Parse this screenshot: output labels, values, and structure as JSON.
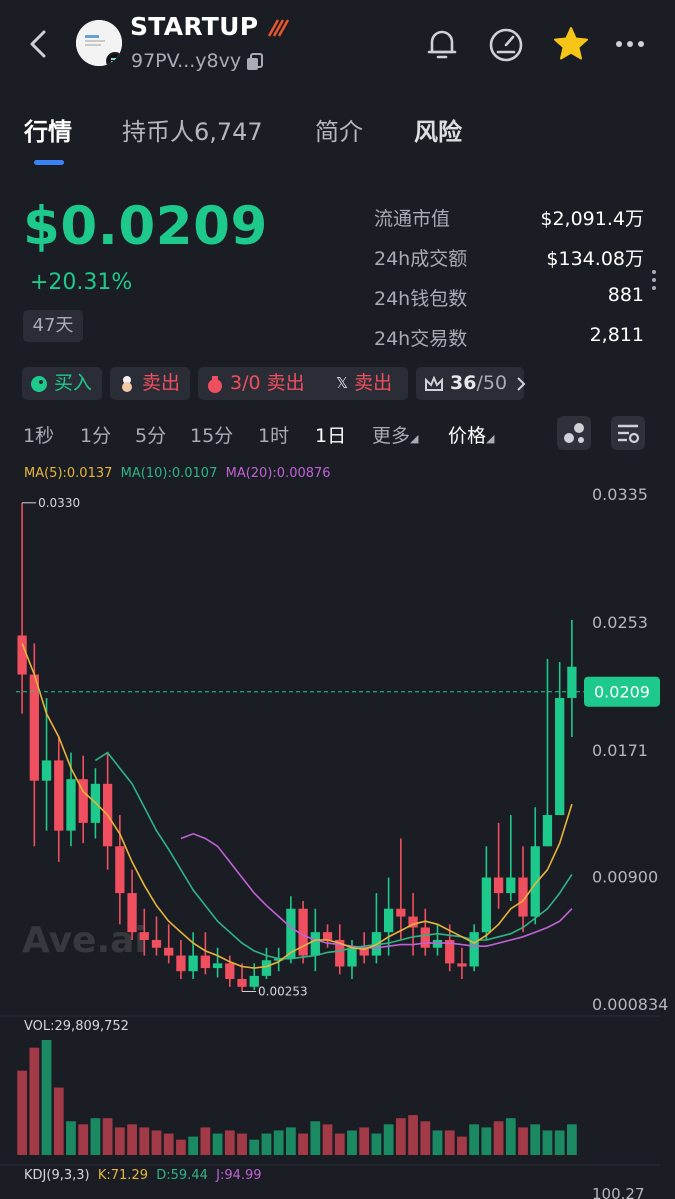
{
  "header": {
    "title": "STARTUP",
    "address": "97PV...y8vy",
    "icons": [
      "back-icon",
      "bell-icon",
      "speedometer-icon",
      "star-icon",
      "more-icon"
    ]
  },
  "tabs": [
    {
      "label": "行情",
      "active": true
    },
    {
      "label": "持币人6,747",
      "active": false
    },
    {
      "label": "简介",
      "active": false
    },
    {
      "label": "风险",
      "active": false
    }
  ],
  "price": {
    "value": "$0.0209",
    "change": "+20.31%",
    "age": "47天"
  },
  "stats": [
    {
      "label": "流通市值",
      "value": "$2,091.4万"
    },
    {
      "label": "24h成交额",
      "value": "$134.08万"
    },
    {
      "label": "24h钱包数",
      "value": "881"
    },
    {
      "label": "24h交易数",
      "value": "2,811"
    }
  ],
  "chips": {
    "buy": "买入",
    "sell1": "卖出",
    "sell2_count": "3/0",
    "sell2": "卖出",
    "sell3": "卖出",
    "rank": "36",
    "rank_total": "/50"
  },
  "timeframes": {
    "items": [
      "1秒",
      "1分",
      "5分",
      "15分",
      "1时",
      "1日",
      "更多",
      "价格"
    ],
    "active": "1日"
  },
  "colors": {
    "up": "#1ec98c",
    "down": "#f04f5f",
    "ma5": "#e7b53a",
    "ma10": "#2eb487",
    "ma20": "#c162d4",
    "accent": "#3b82f6"
  },
  "chart_data": {
    "type": "candlestick",
    "ma_legend": {
      "ma5": "MA(5):0.0137",
      "ma10": "MA(10):0.0107",
      "ma20": "MA(20):0.00876"
    },
    "y_ticks": [
      "0.0335",
      "0.0253",
      "0.0171",
      "0.00900",
      "0.000834"
    ],
    "y_tick_values": [
      0.0335,
      0.0253,
      0.0171,
      0.009,
      0.000834
    ],
    "ylim": [
      0.000834,
      0.0335
    ],
    "current_price_label": "0.0209",
    "current_price": 0.0209,
    "high_label": "0.0330",
    "low_label": "0.00253",
    "candles": [
      [
        0.0245,
        0.022,
        0.033,
        0.0195
      ],
      [
        0.022,
        0.0152,
        0.024,
        0.011
      ],
      [
        0.0152,
        0.0165,
        0.0205,
        0.012
      ],
      [
        0.0165,
        0.012,
        0.018,
        0.01
      ],
      [
        0.012,
        0.0153,
        0.017,
        0.011
      ],
      [
        0.0153,
        0.0125,
        0.0168,
        0.0112
      ],
      [
        0.0125,
        0.015,
        0.016,
        0.0115
      ],
      [
        0.015,
        0.011,
        0.017,
        0.0095
      ],
      [
        0.011,
        0.008,
        0.013,
        0.006
      ],
      [
        0.008,
        0.0055,
        0.0095,
        0.005
      ],
      [
        0.0055,
        0.005,
        0.007,
        0.004
      ],
      [
        0.005,
        0.0045,
        0.0065,
        0.004
      ],
      [
        0.0045,
        0.004,
        0.006,
        0.0035
      ],
      [
        0.004,
        0.003,
        0.005,
        0.0025
      ],
      [
        0.003,
        0.004,
        0.0055,
        0.0025
      ],
      [
        0.004,
        0.0032,
        0.0055,
        0.0028
      ],
      [
        0.0032,
        0.0035,
        0.0045,
        0.0026
      ],
      [
        0.0035,
        0.0025,
        0.004,
        0.002
      ],
      [
        0.0025,
        0.002,
        0.0035,
        0.0017
      ],
      [
        0.002,
        0.0027,
        0.0035,
        0.0018
      ],
      [
        0.0027,
        0.0037,
        0.0045,
        0.0025
      ],
      [
        0.0037,
        0.0038,
        0.0045,
        0.003
      ],
      [
        0.0038,
        0.007,
        0.0078,
        0.0035
      ],
      [
        0.007,
        0.004,
        0.0075,
        0.0035
      ],
      [
        0.004,
        0.0055,
        0.007,
        0.003
      ],
      [
        0.0055,
        0.005,
        0.006,
        0.0045
      ],
      [
        0.005,
        0.0033,
        0.006,
        0.0028
      ],
      [
        0.0033,
        0.0045,
        0.005,
        0.0025
      ],
      [
        0.0045,
        0.004,
        0.0055,
        0.0035
      ],
      [
        0.004,
        0.0055,
        0.008,
        0.0035
      ],
      [
        0.0055,
        0.007,
        0.009,
        0.004
      ],
      [
        0.007,
        0.0065,
        0.0115,
        0.005
      ],
      [
        0.0065,
        0.0058,
        0.008,
        0.004
      ],
      [
        0.0058,
        0.0045,
        0.007,
        0.004
      ],
      [
        0.0045,
        0.005,
        0.006,
        0.004
      ],
      [
        0.005,
        0.0035,
        0.006,
        0.003
      ],
      [
        0.0035,
        0.0033,
        0.0045,
        0.0025
      ],
      [
        0.0033,
        0.0055,
        0.006,
        0.003
      ],
      [
        0.0055,
        0.009,
        0.011,
        0.005
      ],
      [
        0.009,
        0.008,
        0.0125,
        0.007
      ],
      [
        0.008,
        0.009,
        0.013,
        0.0075
      ],
      [
        0.009,
        0.0065,
        0.011,
        0.0055
      ],
      [
        0.0065,
        0.011,
        0.0135,
        0.006
      ],
      [
        0.011,
        0.013,
        0.023,
        0.011
      ],
      [
        0.013,
        0.0205,
        0.0228,
        0.0165
      ],
      [
        0.0205,
        0.0225,
        0.0255,
        0.018
      ]
    ],
    "ma5": [
      0.024,
      0.022,
      0.0195,
      0.018,
      0.016,
      0.0145,
      0.0138,
      0.013,
      0.0118,
      0.01,
      0.0085,
      0.0072,
      0.0062,
      0.0055,
      0.0048,
      0.0043,
      0.004,
      0.0036,
      0.0033,
      0.0032,
      0.0033,
      0.0036,
      0.0042,
      0.0046,
      0.005,
      0.005,
      0.0048,
      0.0045,
      0.0044,
      0.0047,
      0.0052,
      0.0056,
      0.006,
      0.0062,
      0.006,
      0.0056,
      0.0052,
      0.0048,
      0.0053,
      0.006,
      0.007,
      0.0075,
      0.0086,
      0.0095,
      0.0112,
      0.0137
    ],
    "ma10": [
      null,
      null,
      null,
      null,
      null,
      null,
      0.0165,
      0.017,
      0.016,
      0.015,
      0.0135,
      0.012,
      0.0108,
      0.0095,
      0.0082,
      0.0072,
      0.0062,
      0.0055,
      0.0048,
      0.0043,
      0.004,
      0.0038,
      0.0038,
      0.0039,
      0.004,
      0.0042,
      0.0043,
      0.0045,
      0.0046,
      0.0047,
      0.0048,
      0.005,
      0.0052,
      0.0053,
      0.0054,
      0.0053,
      0.0052,
      0.005,
      0.005,
      0.0052,
      0.0054,
      0.0058,
      0.0064,
      0.007,
      0.008,
      0.0092
    ],
    "ma20": [
      null,
      null,
      null,
      null,
      null,
      null,
      null,
      null,
      null,
      null,
      null,
      null,
      null,
      0.0115,
      0.0118,
      0.0115,
      0.011,
      0.01,
      0.009,
      0.008,
      0.0072,
      0.0065,
      0.0058,
      0.0053,
      0.005,
      0.0048,
      0.0047,
      0.0046,
      0.0045,
      0.0045,
      0.0046,
      0.0047,
      0.0047,
      0.0048,
      0.0048,
      0.0048,
      0.0047,
      0.0046,
      0.0046,
      0.0048,
      0.005,
      0.0052,
      0.0055,
      0.0058,
      0.0062,
      0.007
    ],
    "volume_label": "VOL:29,809,752",
    "volumes": [
      55,
      70,
      75,
      44,
      22,
      20,
      24,
      24,
      18,
      20,
      18,
      16,
      14,
      10,
      12,
      18,
      14,
      16,
      14,
      10,
      14,
      16,
      18,
      14,
      22,
      20,
      14,
      16,
      18,
      14,
      20,
      24,
      26,
      22,
      16,
      16,
      12,
      20,
      18,
      22,
      24,
      18,
      20,
      16,
      16,
      20,
      20
    ],
    "kdj": {
      "label": "KDJ(9,3,3)",
      "k": "K:71.29",
      "d": "D:59.44",
      "j": "J:94.99",
      "top_tick": "100.27"
    },
    "watermark": "Ave.ai"
  }
}
